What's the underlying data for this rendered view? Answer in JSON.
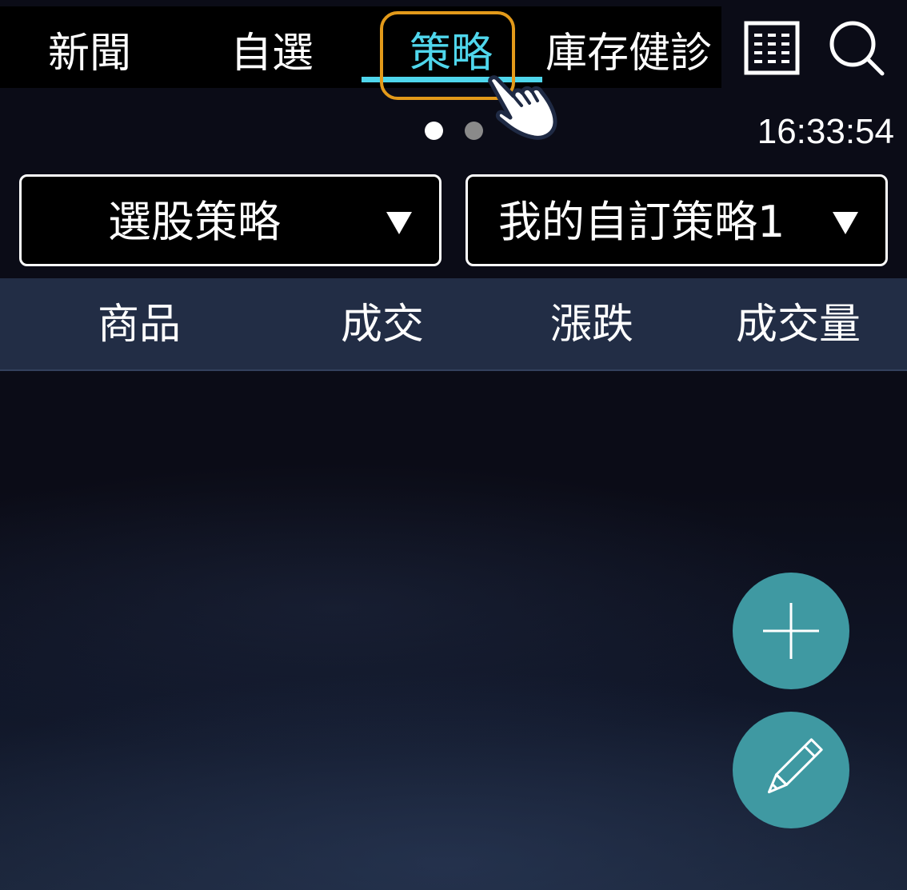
{
  "nav": {
    "tabs": [
      {
        "label": "新聞",
        "active": false
      },
      {
        "label": "自選",
        "active": false
      },
      {
        "label": "策略",
        "active": true
      },
      {
        "label": "庫存健診",
        "active": false
      }
    ],
    "icons": [
      "keypad-icon",
      "search-icon"
    ]
  },
  "pager": {
    "count": 2,
    "active_index": 0
  },
  "clock": "16:33:54",
  "filters": {
    "category": {
      "label": "選股策略",
      "arrow": "▼"
    },
    "strategy": {
      "label": "我的自訂策略1",
      "arrow": "▼"
    }
  },
  "table": {
    "columns": [
      "商品",
      "成交",
      "漲跌",
      "成交量"
    ],
    "rows": []
  },
  "fabs": {
    "add_icon": "plus-icon",
    "edit_icon": "pencil-icon"
  },
  "colors": {
    "accent": "#4fd6ec",
    "highlight": "#e39a1a",
    "fab": "#3f99a2",
    "header_bg": "#222d45"
  }
}
